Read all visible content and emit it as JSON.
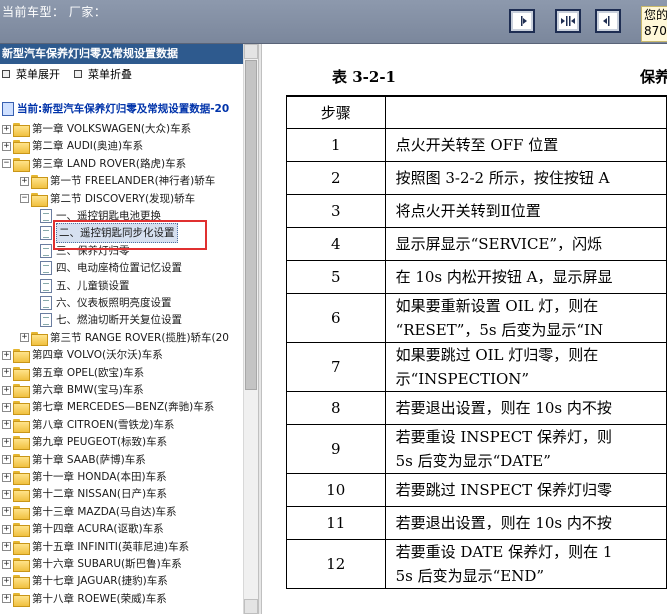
{
  "topbar": {
    "car_type_label": "当前车型：  厂家：",
    "greeting_text": "您的",
    "greeting_number": "870"
  },
  "left": {
    "header": "新型汽车保养灯归零及常规设置数据",
    "expand_all": "菜单展开",
    "collapse_all": "菜单折叠",
    "tree": [
      {
        "label": "当前:新型汽车保养灯归零及常规设置数据-20",
        "type": "root"
      },
      {
        "label": "第一章 VOLKSWAGEN(大众)车系",
        "type": "folder",
        "exp": "+"
      },
      {
        "label": "第二章 AUDI(奥迪)车系",
        "type": "folder",
        "exp": "+"
      },
      {
        "label": "第三章 LAND ROVER(路虎)车系",
        "type": "folder",
        "exp": "-"
      },
      {
        "label": "第一节 FREELANDER(神行者)轿车",
        "type": "folder",
        "exp": "+"
      },
      {
        "label": "第二节 DISCOVERY(发现)轿车",
        "type": "folder",
        "exp": "-"
      },
      {
        "label": "一、遥控钥匙电池更换",
        "type": "doc"
      },
      {
        "label": "二、遥控钥匙同步化设置",
        "type": "doc",
        "selected": true
      },
      {
        "label": "三、保养灯归零",
        "type": "doc"
      },
      {
        "label": "四、电动座椅位置记忆设置",
        "type": "doc"
      },
      {
        "label": "五、儿童锁设置",
        "type": "doc"
      },
      {
        "label": "六、仪表板照明亮度设置",
        "type": "doc"
      },
      {
        "label": "七、燃油切断开关复位设置",
        "type": "doc"
      },
      {
        "label": "第三节 RANGE ROVER(揽胜)轿车(20",
        "type": "folder",
        "exp": "+"
      },
      {
        "label": "第四章 VOLVO(沃尔沃)车系",
        "type": "folder",
        "exp": "+"
      },
      {
        "label": "第五章 OPEL(欧宝)车系",
        "type": "folder",
        "exp": "+"
      },
      {
        "label": "第六章 BMW(宝马)车系",
        "type": "folder",
        "exp": "+"
      },
      {
        "label": "第七章 MERCEDES—BENZ(奔驰)车系",
        "type": "folder",
        "exp": "+"
      },
      {
        "label": "第八章 CITROEN(雪铁龙)车系",
        "type": "folder",
        "exp": "+"
      },
      {
        "label": "第九章 PEUGEOT(标致)车系",
        "type": "folder",
        "exp": "+"
      },
      {
        "label": "第十章 SAAB(萨博)车系",
        "type": "folder",
        "exp": "+"
      },
      {
        "label": "第十一章 HONDA(本田)车系",
        "type": "folder",
        "exp": "+"
      },
      {
        "label": "第十二章 NISSAN(日产)车系",
        "type": "folder",
        "exp": "+"
      },
      {
        "label": "第十三章 MAZDA(马自达)车系",
        "type": "folder",
        "exp": "+"
      },
      {
        "label": "第十四章 ACURA(讴歌)车系",
        "type": "folder",
        "exp": "+"
      },
      {
        "label": "第十五章 INFINITI(英菲尼迪)车系",
        "type": "folder",
        "exp": "+"
      },
      {
        "label": "第十六章 SUBARU(斯巴鲁)车系",
        "type": "folder",
        "exp": "+"
      },
      {
        "label": "第十七章 JAGUAR(捷豹)车系",
        "type": "folder",
        "exp": "+"
      },
      {
        "label": "第十八章 ROEWE(荣威)车系",
        "type": "folder",
        "exp": "+"
      }
    ]
  },
  "doc": {
    "table_label": "表 3-2-1",
    "table_title_fragment": "保养",
    "step_header": "步骤",
    "rows": [
      {
        "step": "1",
        "lines": [
          "点火开关转至 OFF 位置"
        ]
      },
      {
        "step": "2",
        "lines": [
          "按照图 3-2-2 所示，按住按钮 A"
        ]
      },
      {
        "step": "3",
        "lines": [
          "将点火开关转到Ⅱ位置"
        ]
      },
      {
        "step": "4",
        "lines": [
          "显示屏显示“SERVICE”，闪烁"
        ]
      },
      {
        "step": "5",
        "lines": [
          "在 10s 内松开按钮 A，显示屏显"
        ]
      },
      {
        "step": "6",
        "lines": [
          "如果要重新设置 OIL 灯，则在",
          "“RESET”，5s 后变为显示“IN"
        ]
      },
      {
        "step": "7",
        "lines": [
          "如果要跳过 OIL 灯归零，则在",
          "示“INSPECTION”"
        ]
      },
      {
        "step": "8",
        "lines": [
          "若要退出设置，则在 10s 内不按"
        ]
      },
      {
        "step": "9",
        "lines": [
          "若要重设 INSPECT 保养灯，则",
          "5s 后变为显示“DATE”"
        ]
      },
      {
        "step": "10",
        "lines": [
          "若要跳过 INSPECT 保养灯归零"
        ]
      },
      {
        "step": "11",
        "lines": [
          "若要退出设置，则在 10s 内不按"
        ]
      },
      {
        "step": "12",
        "lines": [
          "若要重设 DATE 保养灯，则在 1",
          "5s 后变为显示“END”"
        ]
      }
    ]
  }
}
